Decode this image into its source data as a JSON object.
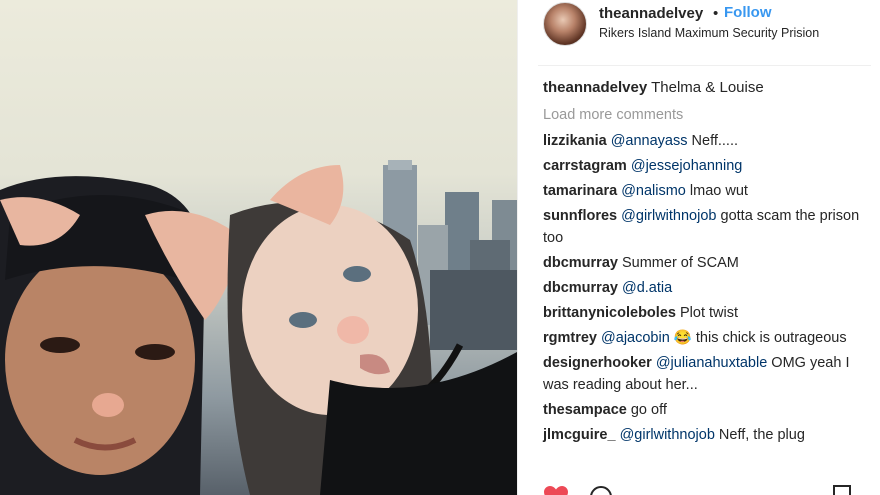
{
  "post": {
    "username": "theannadelvey",
    "separator": "•",
    "follow_label": "Follow",
    "location": "Rikers Island Maximum Security Prision"
  },
  "caption": {
    "user": "theannadelvey",
    "text": "Thelma & Louise"
  },
  "load_more": "Load more comments",
  "comments": [
    {
      "user": "lizzikania",
      "mention": "@annayass",
      "text": " Neff....."
    },
    {
      "user": "carrstagram",
      "mention": "@jessejohanning",
      "text": ""
    },
    {
      "user": "tamarinara",
      "mention": "@nalismo",
      "text": " lmao wut"
    },
    {
      "user": "sunnflores",
      "mention": "@girlwithnojob",
      "text": " gotta scam the prison too"
    },
    {
      "user": "dbcmurray",
      "mention": "",
      "text": "Summer of SCAM"
    },
    {
      "user": "dbcmurray",
      "mention": "@d.atia",
      "text": ""
    },
    {
      "user": "brittanynicoleboles",
      "mention": "",
      "text": "Plot twist"
    },
    {
      "user": "rgmtrey",
      "mention": "@ajacobin",
      "text": " 😂  this chick is outrageous"
    },
    {
      "user": "designerhooker",
      "mention": "@julianahuxtable",
      "text": " OMG yeah I was reading about her..."
    },
    {
      "user": "thesampace",
      "mention": "",
      "text": "go off"
    },
    {
      "user": "jlmcguire_",
      "mention": "@girlwithnojob",
      "text": " Neff, the plug"
    }
  ],
  "icons": {
    "like": "heart-icon",
    "comment": "comment-icon",
    "save": "bookmark-icon",
    "like_color": "#ed4956"
  }
}
